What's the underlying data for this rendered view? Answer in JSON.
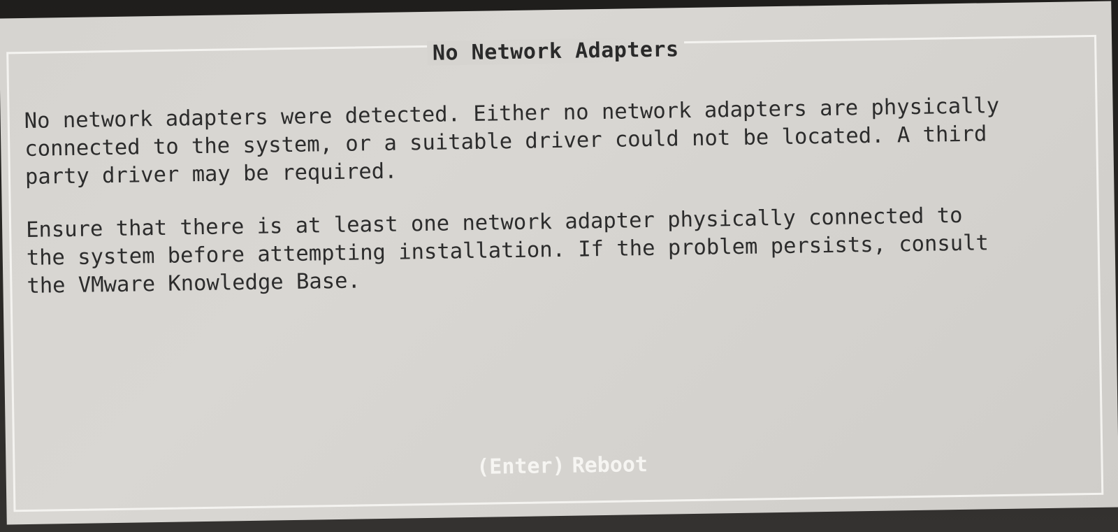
{
  "dialog": {
    "title": "No Network Adapters",
    "paragraph1": [
      "No network adapters were detected. Either no network adapters are physically",
      "connected to the system, or a suitable driver could not be located. A third",
      "party driver may be required."
    ],
    "paragraph2": [
      "Ensure that there is at least one network adapter physically connected to",
      "the system before attempting installation. If the problem persists, consult",
      "the VMware Knowledge Base."
    ],
    "action_key": "(Enter)",
    "action_label": "Reboot"
  }
}
